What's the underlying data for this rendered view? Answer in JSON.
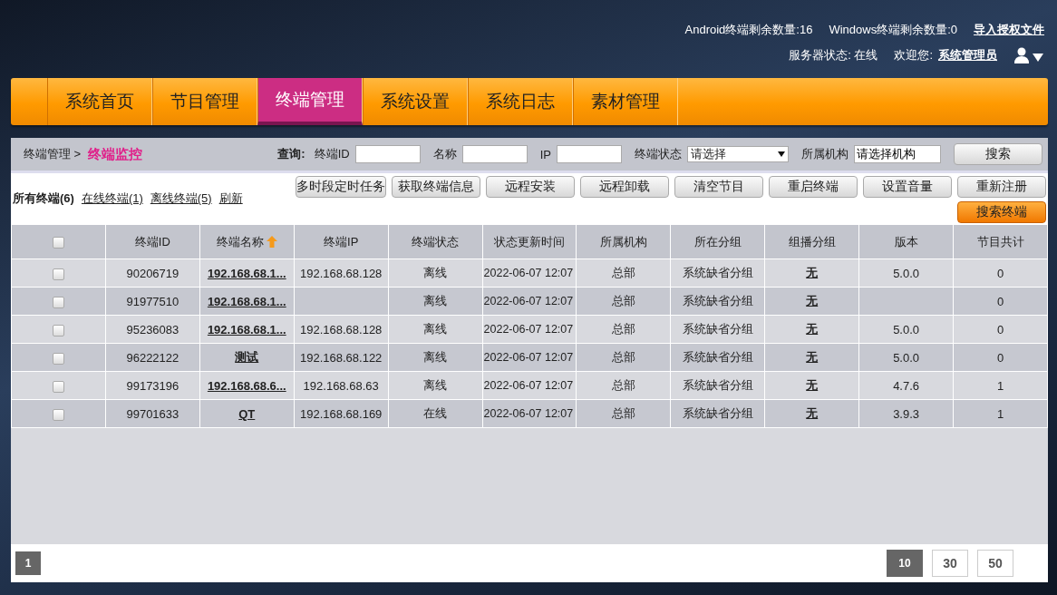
{
  "header": {
    "android_count": "Android终端剩余数量:16",
    "windows_count": "Windows终端剩余数量:0",
    "import_link": "导入授权文件",
    "server_status": "服务器状态: 在线",
    "welcome": "欢迎您:",
    "user_link": "系统管理员"
  },
  "nav": [
    {
      "label": "系统首页",
      "selected": false
    },
    {
      "label": "节目管理",
      "selected": false
    },
    {
      "label": "终端管理",
      "selected": true
    },
    {
      "label": "系统设置",
      "selected": false
    },
    {
      "label": "系统日志",
      "selected": false
    },
    {
      "label": "素材管理",
      "selected": false
    }
  ],
  "breadcrumb": {
    "parent": "终端管理 >",
    "current": "终端监控"
  },
  "query": {
    "label": "查询:",
    "fields": [
      {
        "kind": "input",
        "label": "终端ID"
      },
      {
        "kind": "input",
        "label": "名称"
      },
      {
        "kind": "input",
        "label": "IP"
      },
      {
        "kind": "select",
        "label": "终端状态",
        "value": "请选择"
      },
      {
        "kind": "input",
        "label": "所属机构",
        "value": "请选择机构"
      }
    ],
    "button": "搜索"
  },
  "filters": [
    {
      "label": "所有终端(6)",
      "selected": true
    },
    {
      "label": "在线终端(1)",
      "selected": false
    },
    {
      "label": "离线终端(5)",
      "selected": false
    },
    {
      "label": "刷新",
      "selected": false
    }
  ],
  "actions": [
    "多时段定时任务",
    "获取终端信息",
    "远程安装",
    "远程卸载",
    "清空节目",
    "重启终端",
    "设置音量",
    "重新注册"
  ],
  "search_terminal_button": "搜索终端",
  "table": {
    "select_all_checked": false,
    "columns": [
      "终端ID",
      "终端名称",
      "终端IP",
      "终端状态",
      "状态更新时间",
      "所属机构",
      "所在分组",
      "组播分组",
      "版本",
      "节目共计"
    ],
    "rows": [
      {
        "checked": false,
        "cells": [
          "90206719",
          "192.168.68.1...",
          "192.168.68.128",
          "离线",
          "2022-06-07 12:07",
          "总部",
          "系统缺省分组",
          "无",
          "5.0.0",
          "0"
        ]
      },
      {
        "checked": false,
        "cells": [
          "91977510",
          "192.168.68.1...",
          "",
          "离线",
          "2022-06-07 12:07",
          "总部",
          "系统缺省分组",
          "无",
          "",
          "0"
        ]
      },
      {
        "checked": false,
        "cells": [
          "95236083",
          "192.168.68.1...",
          "192.168.68.128",
          "离线",
          "2022-06-07 12:07",
          "总部",
          "系统缺省分组",
          "无",
          "5.0.0",
          "0"
        ]
      },
      {
        "checked": false,
        "cells": [
          "96222122",
          "测试",
          "192.168.68.122",
          "离线",
          "2022-06-07 12:07",
          "总部",
          "系统缺省分组",
          "无",
          "5.0.0",
          "0"
        ]
      },
      {
        "checked": false,
        "cells": [
          "99173196",
          "192.168.68.6...",
          "192.168.68.63",
          "离线",
          "2022-06-07 12:07",
          "总部",
          "系统缺省分组",
          "无",
          "4.7.6",
          "1"
        ]
      },
      {
        "checked": false,
        "cells": [
          "99701633",
          "QT",
          "192.168.68.169",
          "在线",
          "2022-06-07 12:07",
          "总部",
          "系统缺省分组",
          "无",
          "3.9.3",
          "1"
        ]
      }
    ]
  },
  "pages": [
    {
      "label": "1",
      "selected": true
    }
  ],
  "page_sizes": [
    {
      "label": "10",
      "selected": true
    },
    {
      "label": "30",
      "selected": false
    },
    {
      "label": "50",
      "selected": false
    }
  ]
}
